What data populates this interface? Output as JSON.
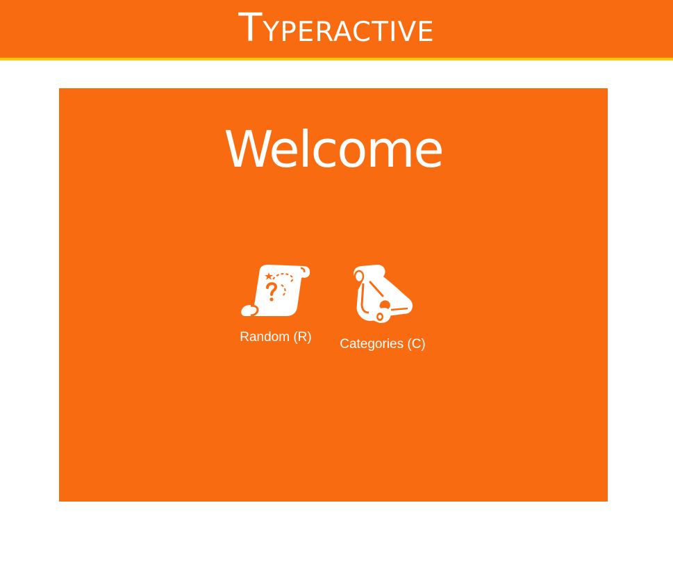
{
  "header": {
    "title": "Typeractive"
  },
  "main": {
    "heading": "Welcome",
    "options": [
      {
        "label": "Random (R)",
        "icon": "scroll-question-icon"
      },
      {
        "label": "Categories (C)",
        "icon": "scroll-categories-icon"
      }
    ]
  },
  "colors": {
    "accent": "#f96b10",
    "header_border": "#ffc800",
    "text": "#ffffff",
    "background": "#ffffff"
  }
}
